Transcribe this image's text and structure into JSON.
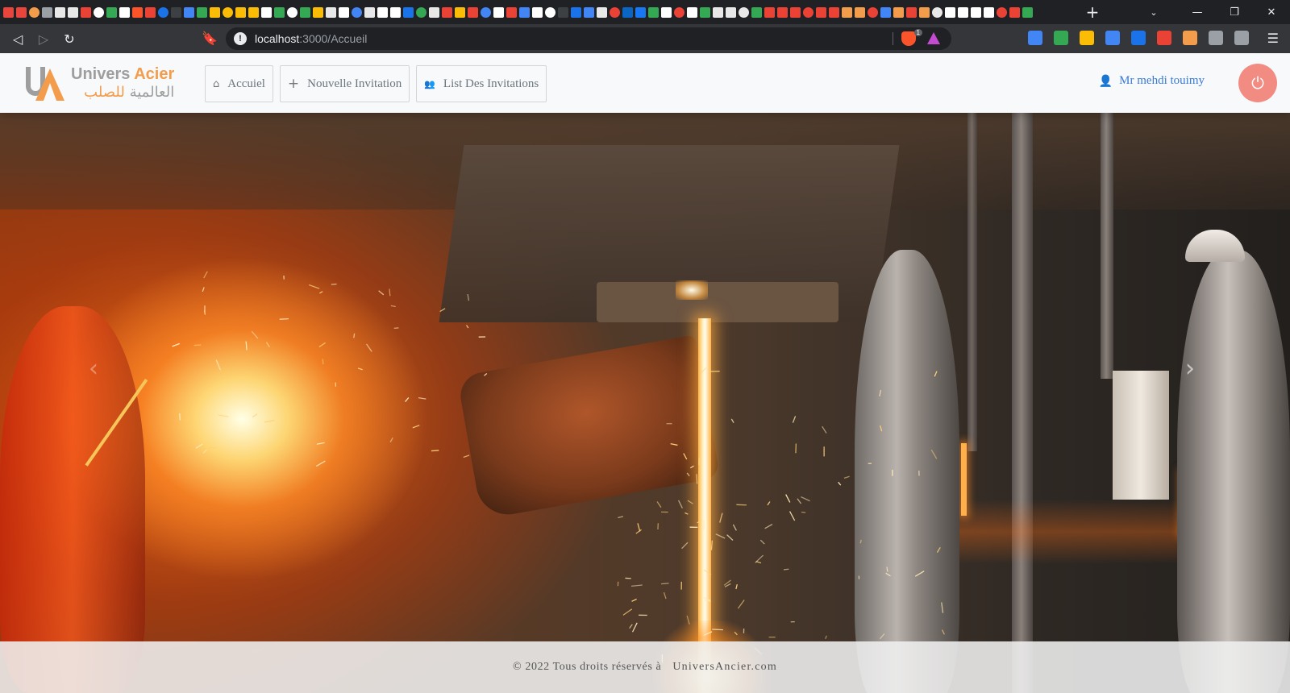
{
  "browser": {
    "url_host": "localhost",
    "url_path": ":3000/Accueil",
    "brave_badge": "1",
    "favicon_colors": [
      "#e8453c",
      "#e8453c",
      "#f39c4b",
      "#9aa0a6",
      "#e8e8e8",
      "#e8e8e8",
      "#ea4335",
      "#ffffff",
      "#34a853",
      "#ffffff",
      "#fb542b",
      "#ea4335",
      "#1a73e8",
      "#3c4043",
      "#4285f4",
      "#34a853",
      "#fbbc05",
      "#fbbc05",
      "#fbbc05",
      "#fbbc05",
      "#ffffff",
      "#34a853",
      "#ffffff",
      "#34a853",
      "#fbbc05",
      "#e8e8e8",
      "#ffffff",
      "#4285f4",
      "#e8e8e8",
      "#ffffff",
      "#ffffff",
      "#1a73e8",
      "#34a853",
      "#e8e8e8",
      "#ea4335",
      "#fbbc05",
      "#ea4335",
      "#4285f4",
      "#ffffff",
      "#ea4335",
      "#4285f4",
      "#ffffff",
      "#ffffff",
      "#3c4043",
      "#1a73e8",
      "#4285f4",
      "#e8e8e8",
      "#ea4335",
      "#0a66c2",
      "#1877f2",
      "#34a853",
      "#ffffff",
      "#ea4335",
      "#ffffff",
      "#34a853",
      "#e8e8e8",
      "#e8e8e8",
      "#e8e8e8",
      "#34a853",
      "#ea4335",
      "#ea4335",
      "#ea4335",
      "#ea4335",
      "#ea4335",
      "#ea4335",
      "#f39c4b",
      "#f39c4b",
      "#ea4335",
      "#4285f4",
      "#f39c4b",
      "#ea4335",
      "#f39c4b",
      "#e8e8e8",
      "#ffffff",
      "#ffffff",
      "#ffffff",
      "#ffffff",
      "#ea4335",
      "#ea4335",
      "#34a853"
    ],
    "extension_colors": [
      "#4285f4",
      "#34a853",
      "#fbbc05",
      "#4285f4",
      "#1a73e8",
      "#ea4335",
      "#f39c4b",
      "#9aa0a6",
      "#9aa0a6"
    ]
  },
  "navbar": {
    "logo_en_1": "Univers",
    "logo_en_2": "Acier",
    "logo_ar_1": "العالمية",
    "logo_ar_2": "للصلب",
    "items": [
      {
        "icon": "⌂",
        "label": "Accuiel"
      },
      {
        "icon": "+",
        "label": "Nouvelle Invitation"
      },
      {
        "icon": "👥",
        "label": "List Des Invitations"
      }
    ],
    "user_name": "Mr mehdi touimy",
    "colors": {
      "accent": "#f39c4b",
      "user": "#3a7bd5",
      "power": "#f28b82"
    }
  },
  "carousel": {
    "prev": "‹",
    "next": "›"
  },
  "footer": {
    "copyright": "© 2022 Tous droits réservés à",
    "site": "UniversAncier.com"
  }
}
